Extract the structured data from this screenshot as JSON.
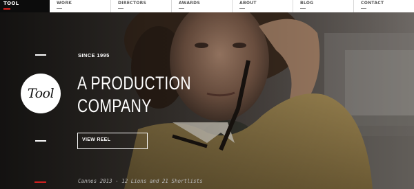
{
  "brand": {
    "label": "TOOL",
    "accent": "#e0201b"
  },
  "nav": {
    "items": [
      {
        "label": "WORK"
      },
      {
        "label": "DIRECTORS"
      },
      {
        "label": "AWARDS"
      },
      {
        "label": "ABOUT"
      },
      {
        "label": "BLOG"
      },
      {
        "label": "CONTACT"
      }
    ]
  },
  "logo": {
    "text": "Tool"
  },
  "hero": {
    "since": "SINCE 1995",
    "headline_line1": "A PRODUCTION",
    "headline_line2": "COMPANY",
    "cta_label": "VIEW REEL",
    "awards_text": "Cannes 2013 - 12 Lions and 21 Shortlists"
  },
  "icons": {
    "logo": "tool-logo-circle",
    "background": "hero-background-image"
  }
}
